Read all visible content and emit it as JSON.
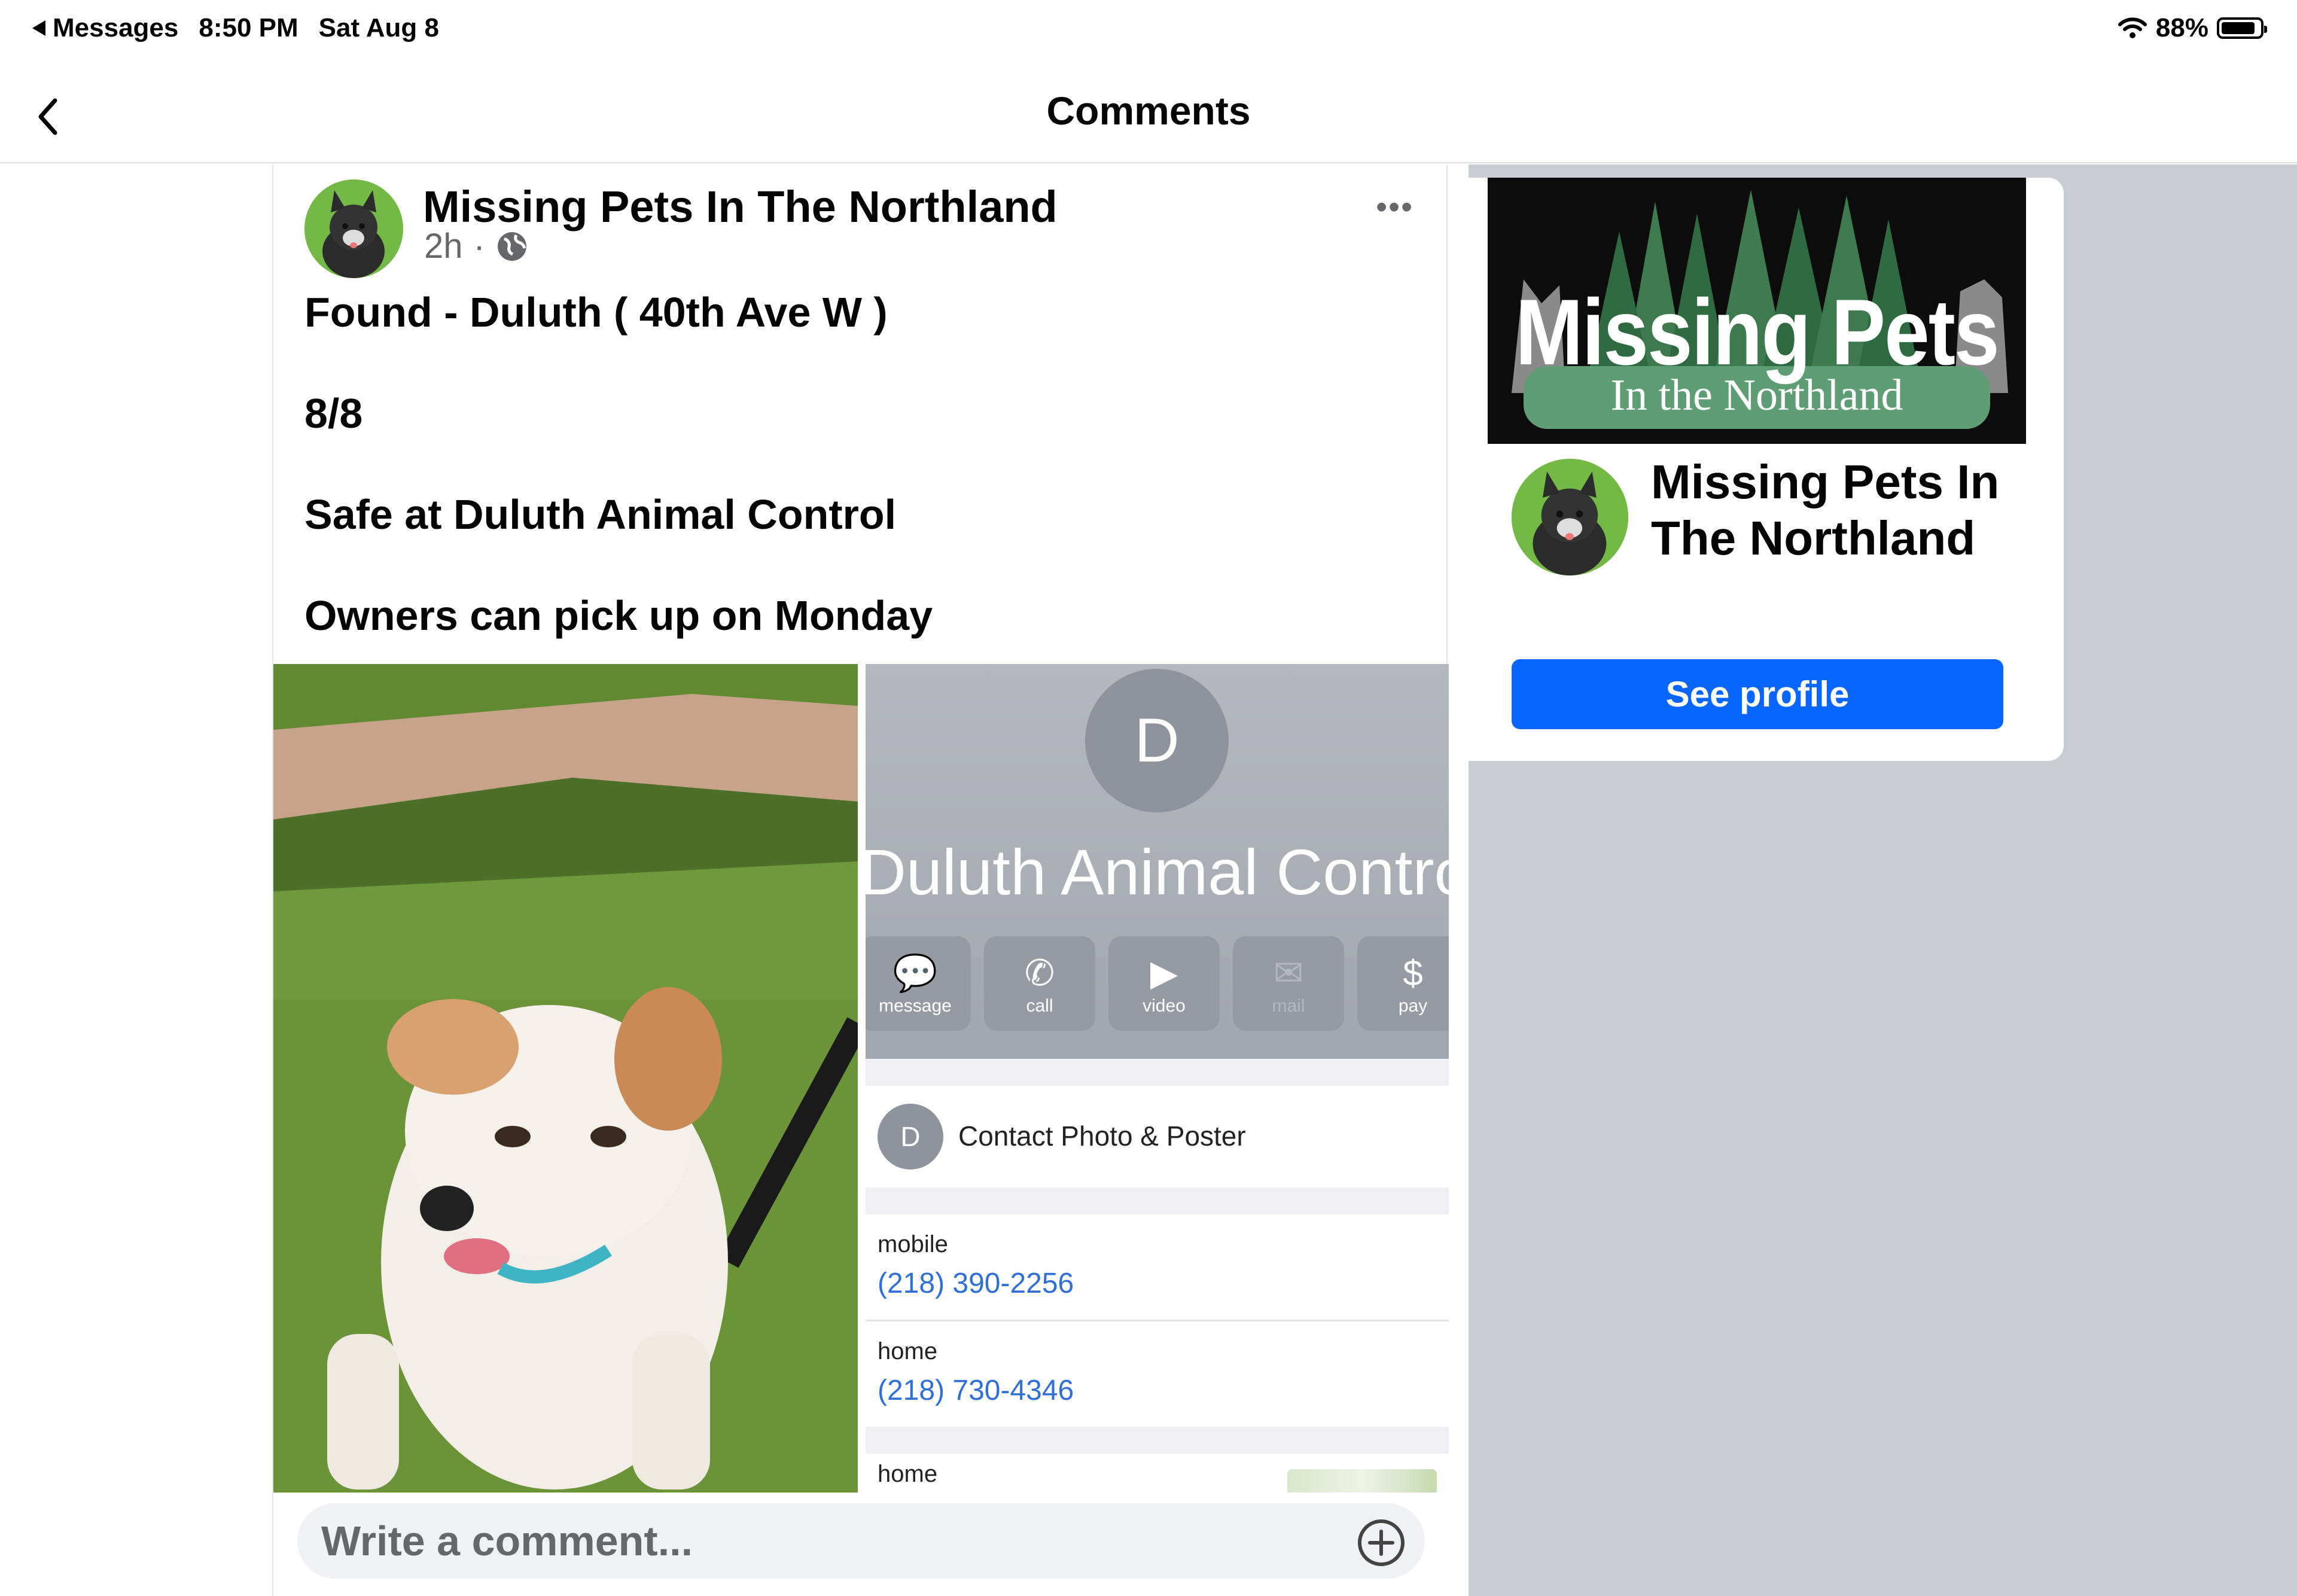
{
  "status_bar": {
    "back_app": "Messages",
    "time": "8:50 PM",
    "date": "Sat Aug 8",
    "battery_percent": "88%",
    "battery_level": 0.88
  },
  "nav": {
    "title": "Comments"
  },
  "post": {
    "author": "Missing Pets In The Northland",
    "time_ago": "2h",
    "separator": "·",
    "lines": [
      "Found - Duluth ( 40th Ave W )",
      "8/8",
      "Safe at Duluth Animal Control",
      "Owners can pick up on Monday"
    ],
    "contact_screenshot": {
      "initial": "D",
      "name": "Duluth Animal Contro",
      "actions": [
        "message",
        "call",
        "video",
        "mail",
        "pay"
      ],
      "contact_photo_row": "Contact Photo & Poster",
      "mobile_label": "mobile",
      "mobile_number": "(218) 390-2256",
      "home_label": "home",
      "home_number": "(218) 730-4346",
      "home2_label": "home"
    }
  },
  "comment_box": {
    "placeholder": "Write a comment..."
  },
  "profile_card": {
    "banner_title": "Missing Pets",
    "banner_subtitle": "In the Northland",
    "name": "Missing Pets In The Northland",
    "button": "See profile"
  },
  "colors": {
    "accent_blue": "#0866ff",
    "link_blue": "#2f6fd6",
    "side_panel": "#c9ccd3"
  }
}
